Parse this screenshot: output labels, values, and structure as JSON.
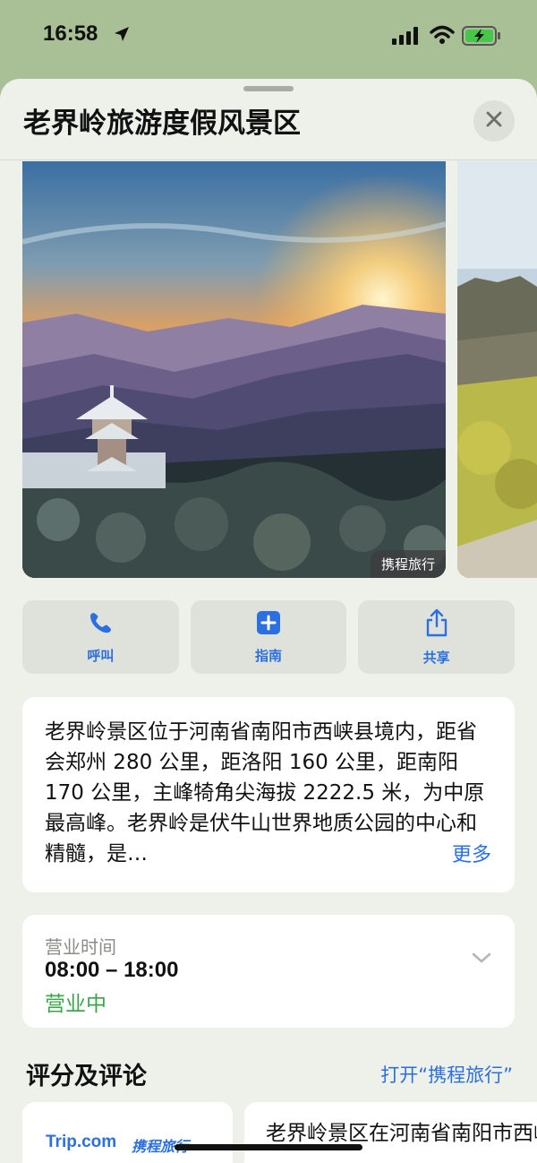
{
  "status": {
    "time": "16:58"
  },
  "sheet": {
    "title": "老界岭旅游度假风景区",
    "photo_credit": "携程旅行"
  },
  "actions": [
    {
      "label": "呼叫",
      "icon": "phone-icon"
    },
    {
      "label": "指南",
      "icon": "plus-square-icon"
    },
    {
      "label": "共享",
      "icon": "share-icon"
    }
  ],
  "description": {
    "text": "老界岭景区位于河南省南阳市西峡县境内，距省会郑州 280 公里，距洛阳 160 公里，距南阳 170 公里，主峰犄角尖海拔 2222.5 米，为中原最高峰。老界岭是伏牛山世界地质公园的中心和精髓，是…",
    "more": "更多"
  },
  "hours": {
    "label": "营业时间",
    "value": "08:00 – 18:00",
    "state": "营业中"
  },
  "reviews": {
    "title": "评分及评论",
    "open_link": "打开“携程旅行”",
    "brand": "Trip.com",
    "brand_cn": "携程旅行",
    "snippet": "老界岭景区在河南省南阳市西峡县北部，相传老子曾在老界岭"
  },
  "colors": {
    "accent": "#2b6fe0",
    "open_green": "#3ca54a",
    "sheet_bg": "#eef1ea"
  }
}
